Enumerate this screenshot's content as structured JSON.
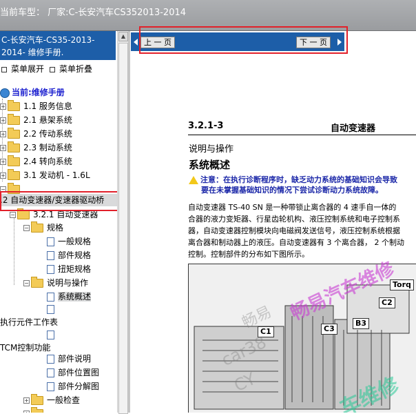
{
  "window": {
    "title": "当前车型： 厂家:C-长安汽车CS352013-2014"
  },
  "sidebar": {
    "header": "C-长安汽车-CS35-2013-2014- 维修手册.",
    "expand_label": "菜单展开",
    "collapse_label": "菜单折叠",
    "root_label": "当前:维修手册",
    "items": [
      {
        "label": "1.1 服务信息"
      },
      {
        "label": "2.1 悬架系统"
      },
      {
        "label": "2.2 传动系统"
      },
      {
        "label": "2.3 制动系统"
      },
      {
        "label": "2.4 转向系统"
      },
      {
        "label": "3.1 发动机 - 1.6L"
      }
    ],
    "selected_chapter": ".2 自动变速器/变速器驱动桥",
    "section_321": "3.2.1 自动变速器",
    "spec_folder": "规格",
    "spec_items": [
      "一般规格",
      "部件规格",
      "扭矩规格"
    ],
    "desc_folder": "说明与操作",
    "desc_selected": "系统概述",
    "exec_table": "执行元件工作表",
    "tcm_title": "TCM控制功能",
    "tcm_items": [
      "部件说明",
      "部件位置图",
      "部件分解图"
    ],
    "general_check": "一般检查"
  },
  "nav": {
    "prev_label": "上 一 页",
    "next_label": "下 一 页"
  },
  "document": {
    "section_no": "3.2.1-3",
    "section_title": "自动变速器",
    "sub_heading": "说明与操作",
    "heading": "系统概述",
    "note_line1": "注意：在执行诊断程序时，缺乏动力系统的基础知识会导致",
    "note_line2": "要在未掌握基础知识的情况下尝试诊断动力系统故障。",
    "body_lines": [
      "自动变速器 TS-40 SN 是一种带锁止离合器的 4 速手自一体的",
      "合器的液力变矩器、行星齿轮机构、液压控制系统和电子控制系",
      "器，自动变速器控制模块向电磁阀发送信号，液压控制系统根据",
      "离合器和制动器上的液压。自动变速器有 3 个离合器， 2 个制动",
      "控制。控制部件的分布如下图所示。"
    ],
    "diagram_labels": [
      "Torq",
      "C2",
      "B3",
      "C1",
      "C3"
    ],
    "watermark1": "畅易",
    "watermark2": "畅易汽车维修",
    "watermark3": "car38",
    "watermark4": "CY",
    "watermark5": "车维修"
  }
}
